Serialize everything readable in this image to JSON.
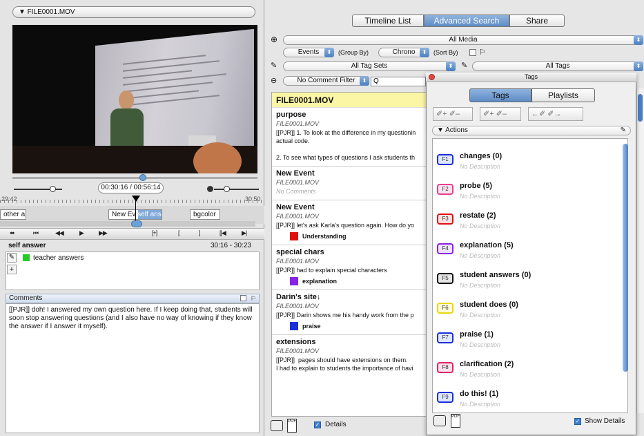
{
  "left": {
    "file_title": "▼ FILE0001.MOV",
    "timecode": "00:30:16 / 00:56:14",
    "ruler_start": "29:42",
    "ruler_end": "30:50",
    "clips": [
      "other a",
      "New Ev",
      "self ans",
      "bgcolor"
    ],
    "transport_buttons": [
      "⬌",
      "⏮",
      "◀◀",
      "▶",
      "▶▶",
      "[+]",
      "[",
      "]",
      "[|◀",
      "▶|"
    ],
    "event": {
      "title": "self answer",
      "time": "30:16 - 30:23"
    },
    "tag": {
      "label": "teacher answers",
      "color": "#22cc22"
    },
    "comments_header": "Comments",
    "comments_text": "[[PJR]]  doh! I answered my own question here. If I keep doing that, students will soon stop answering questions (and I also have no way of knowing if they know the answer if I answer it myself)."
  },
  "right": {
    "tabs": [
      "Timeline List",
      "Advanced Search",
      "Share"
    ],
    "active_tab": "Advanced Search",
    "media_filter": "All Media",
    "group_by_value": "Events",
    "group_by_label": "(Group By)",
    "sort_by_value": "Chrono",
    "sort_by_label": "(Sort By)",
    "tag_sets": "All Tag Sets",
    "all_tags": "All Tags",
    "comment_filter": "No Comment Filter",
    "search_placeholder": "Q",
    "list_header": "FILE0001.MOV",
    "events": [
      {
        "title": "purpose",
        "file": "FILE0001.MOV",
        "text": "[[PJR]] 1. To look at the difference in my questionin\nactual code.\n\n2. To see what types of questions I ask students th"
      },
      {
        "title": "New Event",
        "file": "FILE0001.MOV",
        "text": "No Comments"
      },
      {
        "title": "New Event",
        "file": "FILE0001.MOV",
        "text": "[[PJR]]  let's ask Karla's question again. How do yo",
        "tag": "Understanding",
        "tag_color": "#e01010"
      },
      {
        "title": "special chars",
        "file": "FILE0001.MOV",
        "text": "[[PJR]]  had to explain special characters",
        "tag": "explanation",
        "tag_color": "#8a22e6"
      },
      {
        "title": "Darin's site↓",
        "file": "FILE0001.MOV",
        "text": "[[PJR]]  Darin shows me his handy work from the p",
        "tag": "praise",
        "tag_color": "#1a2fd8"
      },
      {
        "title": "extensions",
        "file": "FILE0001.MOV",
        "text": "[[PJR]]  pages should have extensions on them.\nI had to explain to students the importance of havi"
      }
    ],
    "details_label": "Details"
  },
  "tags_panel": {
    "window_title": "Tags",
    "tabs": [
      "Tags",
      "Playlists"
    ],
    "actions_label": "▼ Actions",
    "tools": [
      "✐+ ✐–",
      "✐+ ✐–",
      "←✐ ✐→"
    ],
    "show_details_label": "Show Details",
    "tags": [
      {
        "key": "F1",
        "name": "changes (0)",
        "desc": "No Description",
        "color": "#1a2fd8"
      },
      {
        "key": "F2",
        "name": "probe (5)",
        "desc": "No Description",
        "color": "#e83d8e"
      },
      {
        "key": "F3",
        "name": "restate (2)",
        "desc": "No Description",
        "color": "#e01010"
      },
      {
        "key": "F4",
        "name": "explanation (5)",
        "desc": "No Description",
        "color": "#8a22e6"
      },
      {
        "key": "F5",
        "name": "student answers (0)",
        "desc": "No Description",
        "color": "#111111"
      },
      {
        "key": "F6",
        "name": "student does (0)",
        "desc": "No Description",
        "color": "#e6d80a"
      },
      {
        "key": "F7",
        "name": "praise (1)",
        "desc": "No Description",
        "color": "#1a2fd8"
      },
      {
        "key": "F8",
        "name": "clarification (2)",
        "desc": "No Description",
        "color": "#e0246a"
      },
      {
        "key": "F9",
        "name": "do this! (1)",
        "desc": "No Description",
        "color": "#1a2fd8"
      }
    ]
  }
}
